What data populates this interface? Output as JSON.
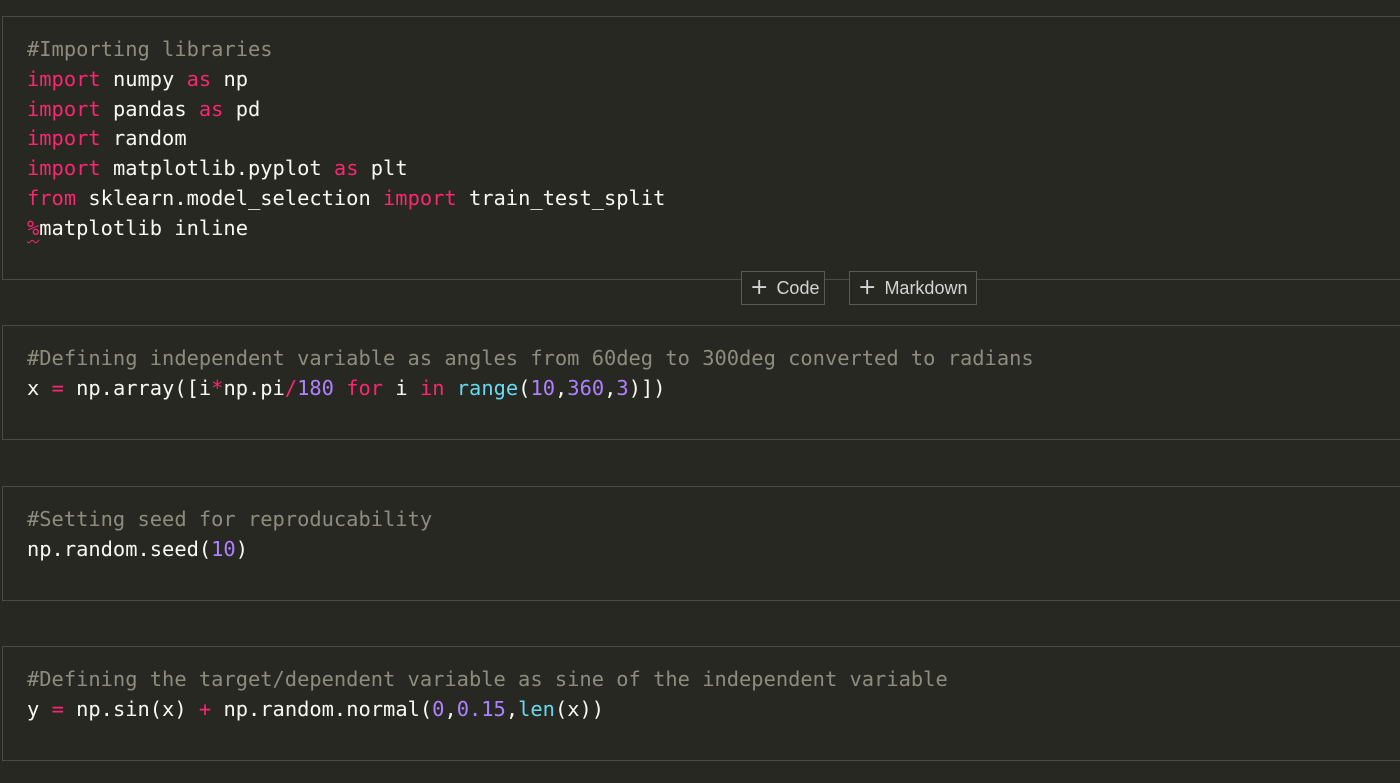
{
  "toolbar": {
    "add_code_label": "Code",
    "add_markdown_label": "Markdown",
    "plus_icon": "+"
  },
  "cells": [
    {
      "lines": [
        [
          {
            "t": "#Importing libraries",
            "c": "cm"
          }
        ],
        [
          {
            "t": "import",
            "c": "kw"
          },
          {
            "t": " numpy "
          },
          {
            "t": "as",
            "c": "kw"
          },
          {
            "t": " np"
          }
        ],
        [
          {
            "t": "import",
            "c": "kw"
          },
          {
            "t": " pandas "
          },
          {
            "t": "as",
            "c": "kw"
          },
          {
            "t": " pd"
          }
        ],
        [
          {
            "t": "import",
            "c": "kw"
          },
          {
            "t": " random"
          }
        ],
        [
          {
            "t": "import",
            "c": "kw"
          },
          {
            "t": " matplotlib.pyplot "
          },
          {
            "t": "as",
            "c": "kw"
          },
          {
            "t": " plt"
          }
        ],
        [
          {
            "t": "from",
            "c": "kw"
          },
          {
            "t": " sklearn.model_selection "
          },
          {
            "t": "import",
            "c": "kw"
          },
          {
            "t": " train_test_split"
          }
        ],
        [
          {
            "t": "%",
            "c": "op squiggle"
          },
          {
            "t": "matplotlib inline"
          }
        ]
      ]
    },
    {
      "lines": [
        [
          {
            "t": "#Defining independent variable as angles from 60deg to 300deg converted to radians",
            "c": "cm"
          }
        ],
        [
          {
            "t": "x "
          },
          {
            "t": "=",
            "c": "op"
          },
          {
            "t": " np.array([i"
          },
          {
            "t": "*",
            "c": "op"
          },
          {
            "t": "np.pi"
          },
          {
            "t": "/",
            "c": "op"
          },
          {
            "t": "180",
            "c": "num"
          },
          {
            "t": " "
          },
          {
            "t": "for",
            "c": "kw"
          },
          {
            "t": " i "
          },
          {
            "t": "in",
            "c": "kw"
          },
          {
            "t": " "
          },
          {
            "t": "range",
            "c": "fn"
          },
          {
            "t": "("
          },
          {
            "t": "10",
            "c": "num"
          },
          {
            "t": ","
          },
          {
            "t": "360",
            "c": "num"
          },
          {
            "t": ","
          },
          {
            "t": "3",
            "c": "num"
          },
          {
            "t": ")])"
          }
        ]
      ]
    },
    {
      "lines": [
        [
          {
            "t": "#Setting seed for reproducability",
            "c": "cm"
          }
        ],
        [
          {
            "t": "np.random.seed("
          },
          {
            "t": "10",
            "c": "num"
          },
          {
            "t": ")"
          }
        ]
      ]
    },
    {
      "lines": [
        [
          {
            "t": "#Defining the target/dependent variable as sine of the independent variable",
            "c": "cm"
          }
        ],
        [
          {
            "t": "y "
          },
          {
            "t": "=",
            "c": "op"
          },
          {
            "t": " np.sin(x) "
          },
          {
            "t": "+",
            "c": "op"
          },
          {
            "t": " np.random.normal("
          },
          {
            "t": "0",
            "c": "num"
          },
          {
            "t": ","
          },
          {
            "t": "0.15",
            "c": "num"
          },
          {
            "t": ","
          },
          {
            "t": "len",
            "c": "fn"
          },
          {
            "t": "(x))"
          }
        ]
      ]
    }
  ],
  "colors": {
    "background": "#272822",
    "keyword": "#f92672",
    "comment": "#8e8c7e",
    "number": "#ae81ff",
    "builtin": "#66d9ef",
    "text": "#f8f8f2",
    "cell_border": "#4a4a46"
  }
}
